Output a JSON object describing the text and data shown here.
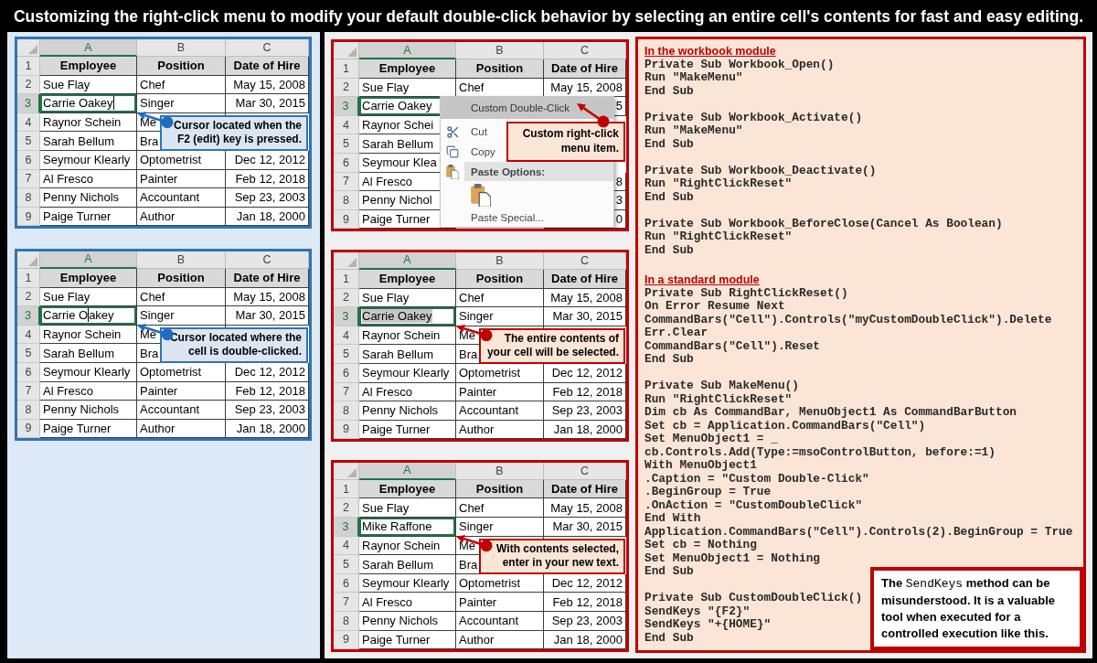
{
  "title": "Customizing the right-click menu to modify your default double-click behavior by selecting an entire cell's contents for fast and easy editing.",
  "left_panel": {
    "sheets": [
      {
        "columns": [
          {
            "label": "A",
            "selected": true
          },
          {
            "label": "B",
            "selected": false
          },
          {
            "label": "C",
            "selected": false
          }
        ],
        "rows": [
          {
            "number": "1",
            "selected": false,
            "kind": "header",
            "cells": [
              "Employee",
              "Position",
              "Date of Hire"
            ]
          },
          {
            "number": "2",
            "selected": false,
            "kind": "data",
            "cells": [
              "Sue Flay",
              "Chef",
              "May 15, 2008"
            ]
          },
          {
            "number": "3",
            "selected": true,
            "kind": "data",
            "cells": [
              {
                "kind": "editing",
                "before_cursor": "Carrie Oakey"
              },
              "Singer",
              "Mar 30, 2015"
            ]
          },
          {
            "number": "4",
            "selected": false,
            "kind": "data",
            "cells": [
              "Raynor Schein",
              "Me",
              null
            ]
          },
          {
            "number": "5",
            "selected": false,
            "kind": "data",
            "cells": [
              "Sarah Bellum",
              "Bra",
              null
            ]
          },
          {
            "number": "6",
            "selected": false,
            "kind": "data",
            "cells": [
              "Seymour Klearly",
              "Optometrist",
              "Dec 12, 2012"
            ]
          },
          {
            "number": "7",
            "selected": false,
            "kind": "data",
            "cells": [
              "Al Fresco",
              "Painter",
              "Feb 12, 2018"
            ]
          },
          {
            "number": "8",
            "selected": false,
            "kind": "data",
            "cells": [
              "Penny Nichols",
              "Accountant",
              "Sep 23, 2003"
            ]
          },
          {
            "number": "9",
            "selected": false,
            "kind": "data",
            "cells": [
              "Paige Turner",
              "Author",
              "Jan 18, 2000"
            ]
          }
        ],
        "callout": {
          "kind": "cell",
          "text": "Cursor located when the F2 (edit) key is pressed."
        }
      },
      {
        "columns": [
          {
            "label": "A",
            "selected": true
          },
          {
            "label": "B",
            "selected": false
          },
          {
            "label": "C",
            "selected": false
          }
        ],
        "rows": [
          {
            "number": "1",
            "selected": false,
            "kind": "header",
            "cells": [
              "Employee",
              "Position",
              "Date of Hire"
            ]
          },
          {
            "number": "2",
            "selected": false,
            "kind": "data",
            "cells": [
              "Sue Flay",
              "Chef",
              "May 15, 2008"
            ]
          },
          {
            "number": "3",
            "selected": true,
            "kind": "data",
            "cells": [
              {
                "kind": "editing",
                "before_cursor": "Carrie O",
                "after_cursor": "akey"
              },
              "Singer",
              "Mar 30, 2015"
            ]
          },
          {
            "number": "4",
            "selected": false,
            "kind": "data",
            "cells": [
              "Raynor Schein",
              "Me",
              null
            ]
          },
          {
            "number": "5",
            "selected": false,
            "kind": "data",
            "cells": [
              "Sarah Bellum",
              "Bra",
              null
            ]
          },
          {
            "number": "6",
            "selected": false,
            "kind": "data",
            "cells": [
              "Seymour Klearly",
              "Optometrist",
              "Dec 12, 2012"
            ]
          },
          {
            "number": "7",
            "selected": false,
            "kind": "data",
            "cells": [
              "Al Fresco",
              "Painter",
              "Feb 12, 2018"
            ]
          },
          {
            "number": "8",
            "selected": false,
            "kind": "data",
            "cells": [
              "Penny Nichols",
              "Accountant",
              "Sep 23, 2003"
            ]
          },
          {
            "number": "9",
            "selected": false,
            "kind": "data",
            "cells": [
              "Paige Turner",
              "Author",
              "Jan 18, 2000"
            ]
          }
        ],
        "callout": {
          "kind": "cell",
          "text": "Cursor located where the cell is double-clicked."
        }
      }
    ]
  },
  "middle_panel": {
    "sheets": [
      {
        "columns": [
          {
            "label": "A",
            "selected": true
          },
          {
            "label": "B",
            "selected": false
          },
          {
            "label": "C",
            "selected": false
          }
        ],
        "rows": [
          {
            "number": "1",
            "selected": false,
            "kind": "header",
            "cells": [
              "Employee",
              "Position",
              "Date of Hire"
            ]
          },
          {
            "number": "2",
            "selected": false,
            "kind": "data",
            "cells": [
              "Sue Flay",
              "Chef",
              "May 15, 2008"
            ]
          },
          {
            "number": "3",
            "selected": true,
            "kind": "data",
            "cells": [
              "Carrie Oakey",
              null,
              "5"
            ]
          },
          {
            "number": "4",
            "selected": false,
            "kind": "data",
            "cells": [
              "Raynor Schei",
              null,
              null
            ]
          },
          {
            "number": "5",
            "selected": false,
            "kind": "data",
            "cells": [
              "Sarah Bellum",
              null,
              null
            ]
          },
          {
            "number": "6",
            "selected": false,
            "kind": "data",
            "cells": [
              "Seymour Klea",
              null,
              null
            ]
          },
          {
            "number": "7",
            "selected": false,
            "kind": "data",
            "cells": [
              "Al Fresco",
              null,
              "8"
            ]
          },
          {
            "number": "8",
            "selected": false,
            "kind": "data",
            "cells": [
              "Penny Nichol",
              null,
              "3"
            ]
          },
          {
            "number": "9",
            "selected": false,
            "kind": "data",
            "cells": [
              "Paige Turner",
              null,
              "0"
            ]
          }
        ],
        "context_menu": {
          "items": [
            {
              "kind": "plain",
              "label": "Custom Double-Click",
              "selected": true
            },
            {
              "kind": "cut",
              "label": "Cut",
              "selected": false
            },
            {
              "kind": "copy",
              "label": "Copy",
              "selected": false
            },
            {
              "kind": "group",
              "label": "Paste Options:"
            },
            {
              "kind": "paste",
              "selected": false
            },
            {
              "kind": "plain",
              "label": "Paste Special...",
              "selected": false
            }
          ]
        },
        "callout": {
          "kind": "menu",
          "text": "Custom right-click menu item."
        }
      },
      {
        "columns": [
          {
            "label": "A",
            "selected": true
          },
          {
            "label": "B",
            "selected": false
          },
          {
            "label": "C",
            "selected": false
          }
        ],
        "rows": [
          {
            "number": "1",
            "selected": false,
            "kind": "header",
            "cells": [
              "Employee",
              "Position",
              "Date of Hire"
            ]
          },
          {
            "number": "2",
            "selected": false,
            "kind": "data",
            "cells": [
              "Sue Flay",
              "Chef",
              "May 15, 2008"
            ]
          },
          {
            "number": "3",
            "selected": true,
            "kind": "data",
            "cells": [
              {
                "kind": "highlighted",
                "text": "Carrie Oakey"
              },
              "Singer",
              "Mar 30, 2015"
            ]
          },
          {
            "number": "4",
            "selected": false,
            "kind": "data",
            "cells": [
              "Raynor Schein",
              "Me",
              null
            ]
          },
          {
            "number": "5",
            "selected": false,
            "kind": "data",
            "cells": [
              "Sarah Bellum",
              "Bra",
              null
            ]
          },
          {
            "number": "6",
            "selected": false,
            "kind": "data",
            "cells": [
              "Seymour Klearly",
              "Optometrist",
              "Dec 12, 2012"
            ]
          },
          {
            "number": "7",
            "selected": false,
            "kind": "data",
            "cells": [
              "Al Fresco",
              "Painter",
              "Feb 12, 2018"
            ]
          },
          {
            "number": "8",
            "selected": false,
            "kind": "data",
            "cells": [
              "Penny Nichols",
              "Accountant",
              "Sep 23, 2003"
            ]
          },
          {
            "number": "9",
            "selected": false,
            "kind": "data",
            "cells": [
              "Paige Turner",
              "Author",
              "Jan 18, 2000"
            ]
          }
        ],
        "callout": {
          "kind": "cell",
          "text": "The entire contents of your cell will be selected."
        }
      },
      {
        "columns": [
          {
            "label": "A",
            "selected": true
          },
          {
            "label": "B",
            "selected": false
          },
          {
            "label": "C",
            "selected": false
          }
        ],
        "rows": [
          {
            "number": "1",
            "selected": false,
            "kind": "header",
            "cells": [
              "Employee",
              "Position",
              "Date of Hire"
            ]
          },
          {
            "number": "2",
            "selected": false,
            "kind": "data",
            "cells": [
              "Sue Flay",
              "Chef",
              "May 15, 2008"
            ]
          },
          {
            "number": "3",
            "selected": true,
            "kind": "data",
            "cells": [
              "Mike Raffone",
              "Singer",
              "Mar 30, 2015"
            ]
          },
          {
            "number": "4",
            "selected": false,
            "kind": "data",
            "cells": [
              "Raynor Schein",
              "Me",
              null
            ]
          },
          {
            "number": "5",
            "selected": false,
            "kind": "data",
            "cells": [
              "Sarah Bellum",
              "Bra",
              null
            ]
          },
          {
            "number": "6",
            "selected": false,
            "kind": "data",
            "cells": [
              "Seymour Klearly",
              "Optometrist",
              "Dec 12, 2012"
            ]
          },
          {
            "number": "7",
            "selected": false,
            "kind": "data",
            "cells": [
              "Al Fresco",
              "Painter",
              "Feb 12, 2018"
            ]
          },
          {
            "number": "8",
            "selected": false,
            "kind": "data",
            "cells": [
              "Penny Nichols",
              "Accountant",
              "Sep 23, 2003"
            ]
          },
          {
            "number": "9",
            "selected": false,
            "kind": "data",
            "cells": [
              "Paige Turner",
              "Author",
              "Jan 18, 2000"
            ]
          }
        ],
        "callout": {
          "kind": "cell",
          "text": "With contents selected, enter in your new text."
        }
      }
    ]
  },
  "code_panel": {
    "sections": [
      {
        "heading": "In the workbook module",
        "blocks": [
          [
            "Private Sub Workbook_Open()",
            "Run \"MakeMenu\"",
            "End Sub"
          ],
          [
            "Private Sub Workbook_Activate()",
            "Run \"MakeMenu\"",
            "End Sub"
          ],
          [
            "Private Sub Workbook_Deactivate()",
            "Run \"RightClickReset\"",
            "End Sub"
          ],
          [
            "Private Sub Workbook_BeforeClose(Cancel As Boolean)",
            "Run \"RightClickReset\"",
            "End Sub"
          ]
        ]
      },
      {
        "heading": "In a standard module",
        "blocks": [
          [
            "Private Sub RightClickReset()",
            "On Error Resume Next",
            "CommandBars(\"Cell\").Controls(\"myCustomDoubleClick\").Delete",
            "Err.Clear",
            "CommandBars(\"Cell\").Reset",
            "End Sub"
          ],
          [
            "Private Sub MakeMenu()",
            "Run \"RightClickReset\"",
            "Dim cb As CommandBar, MenuObject1 As CommandBarButton",
            "Set cb = Application.CommandBars(\"Cell\")",
            "Set MenuObject1 = _",
            "cb.Controls.Add(Type:=msoControlButton, before:=1)",
            "With MenuObject1",
            ".Caption = \"Custom Double-Click\"",
            ".BeginGroup = True",
            ".OnAction = \"CustomDoubleClick\"",
            "End With",
            "Application.CommandBars(\"Cell\").Controls(2).BeginGroup = True",
            "Set cb = Nothing",
            "Set MenuObject1 = Nothing",
            "End Sub"
          ],
          [
            "Private Sub CustomDoubleClick()",
            "SendKeys \"{F2}\"",
            "SendKeys \"+{HOME}\"",
            "End Sub"
          ]
        ]
      }
    ],
    "note": {
      "text_before": "The",
      "code": "SendKeys",
      "text_after": "method can be misunderstood. It is a valuable tool when executed for a controlled execution like this."
    }
  }
}
